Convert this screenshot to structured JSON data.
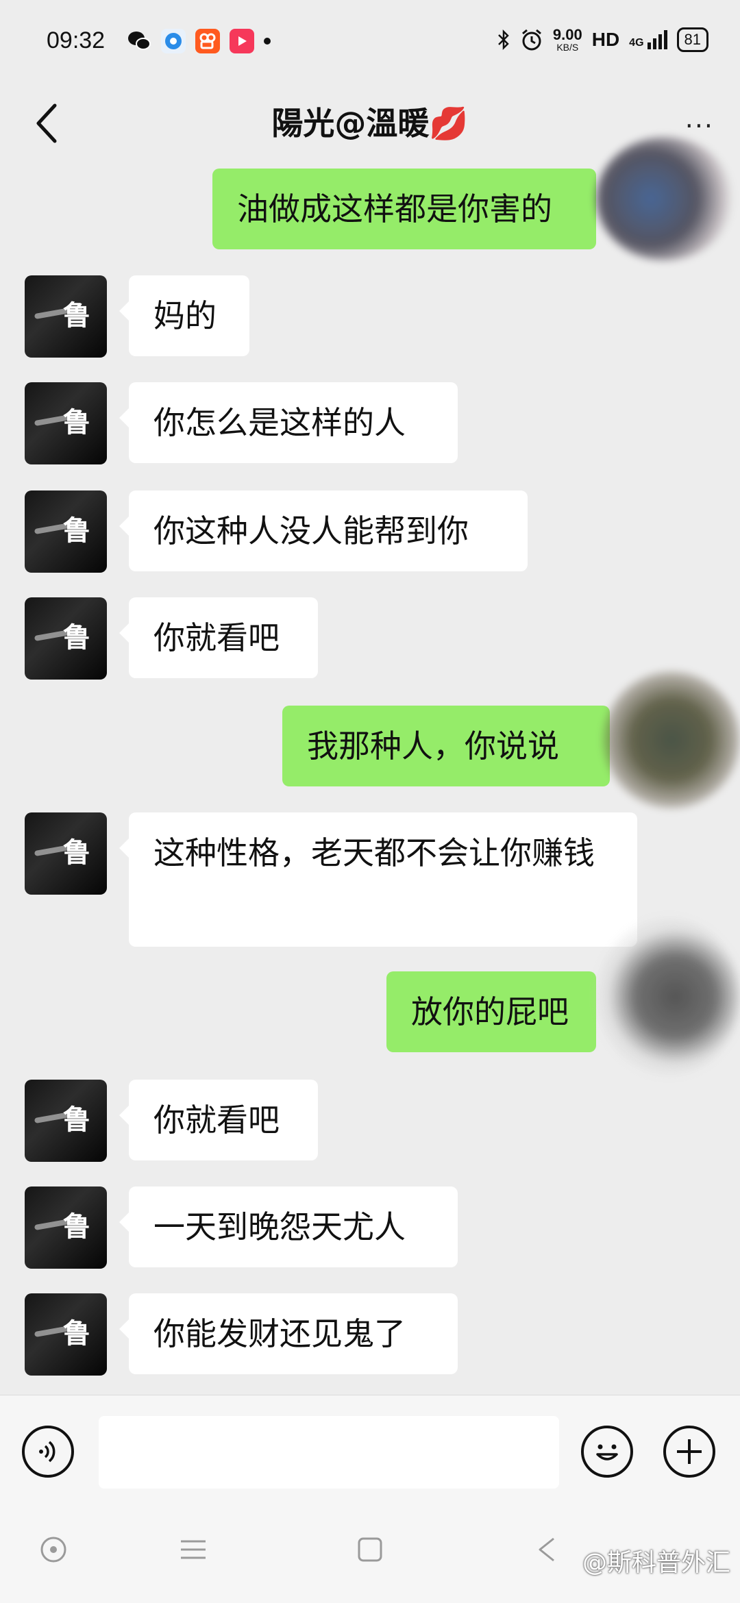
{
  "status_bar": {
    "time": "09:32",
    "network_speed_value": "9.00",
    "network_speed_unit": "KB/S",
    "hd": "HD",
    "signal": "4G",
    "battery": "81",
    "icons": [
      "wechat-icon",
      "circle-app-icon",
      "kuaishou-icon",
      "video-app-icon",
      "dot-icon",
      "bluetooth-icon",
      "alarm-icon",
      "signal-icon"
    ]
  },
  "header": {
    "title": "陽光@溫暖💋",
    "more": "···"
  },
  "messages": [
    {
      "side": "right",
      "text": "油做成这样都是你害的"
    },
    {
      "side": "left",
      "text": "妈的"
    },
    {
      "side": "left",
      "text": "你怎么是这样的人"
    },
    {
      "side": "left",
      "text": "你这种人没人能帮到你"
    },
    {
      "side": "left",
      "text": "你就看吧"
    },
    {
      "side": "right",
      "text": "我那种人，你说说"
    },
    {
      "side": "left",
      "text": "这种性格，老天都不会让你赚钱"
    },
    {
      "side": "right",
      "text": "放你的屁吧"
    },
    {
      "side": "left",
      "text": "你就看吧"
    },
    {
      "side": "left",
      "text": "一天到晚怨天尤人"
    },
    {
      "side": "left",
      "text": "你能发财还见鬼了"
    }
  ],
  "avatar_glyph": "鲁",
  "input": {
    "value": "",
    "placeholder": ""
  },
  "watermark": "@斯科普外汇",
  "colors": {
    "background": "#ededed",
    "bubble_right": "#95ec69",
    "bubble_left": "#ffffff"
  }
}
